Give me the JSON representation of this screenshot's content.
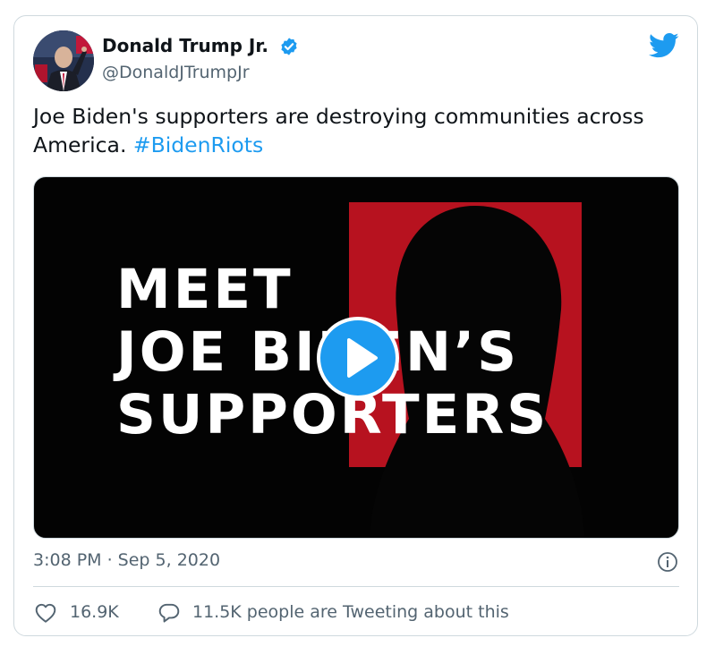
{
  "author": {
    "name": "Donald Trump Jr.",
    "handle": "@DonaldJTrumpJr",
    "verified": true
  },
  "tweet": {
    "text": "Joe Biden's supporters are destroying communities across America.",
    "hashtag": "#BidenRiots"
  },
  "media": {
    "overlay_lines": [
      "MEET",
      "JOE BIDEN’S",
      "SUPPORTERS"
    ],
    "type": "video"
  },
  "meta": {
    "timestamp": "3:08 PM · Sep 5, 2020"
  },
  "stats": {
    "likes": "16.9K",
    "tweeting": "11.5K people are Tweeting about this"
  },
  "colors": {
    "accent": "#1d9bf0",
    "muted": "#536471",
    "border": "#cfd9de",
    "video_red": "#b7121f"
  },
  "icons": [
    "verified-badge-icon",
    "twitter-bird-icon",
    "play-icon",
    "info-icon",
    "heart-icon",
    "reply-bubble-icon"
  ]
}
